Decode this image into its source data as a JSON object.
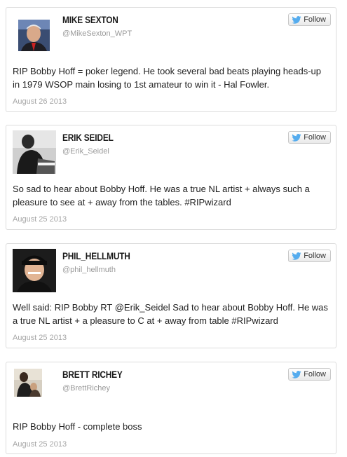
{
  "follow_label": "Follow",
  "colors": {
    "twitter_blue": "#55acee",
    "border": "#dcdcdc",
    "date": "#a5a5a5"
  },
  "tweets": [
    {
      "name": "MIKE SEXTON",
      "handle": "@MikeSexton_WPT",
      "text": "RIP Bobby Hoff = poker legend. He took several bad beats playing heads-up in 1979 WSOP main losing to 1st amateur to win it - Hal Fowler.",
      "date": "August 26 2013"
    },
    {
      "name": "ERIK SEIDEL",
      "handle": "@Erik_Seidel",
      "text": "So sad to hear about Bobby Hoff. He was a true NL artist + always such a pleasure to see at + away from the tables. #RIPwizard",
      "date": "August 25 2013"
    },
    {
      "name": "PHIL_HELLMUTH",
      "handle": "@phil_hellmuth",
      "text": "Well said: RIP Bobby RT @Erik_Seidel Sad to hear about Bobby Hoff. He was a true NL artist + a pleasure to C at + away from table #RIPwizard",
      "date": "August 25 2013"
    },
    {
      "name": "BRETT RICHEY",
      "handle": "@BrettRichey",
      "text": "RIP Bobby Hoff - complete boss",
      "date": "August 25 2013"
    }
  ]
}
